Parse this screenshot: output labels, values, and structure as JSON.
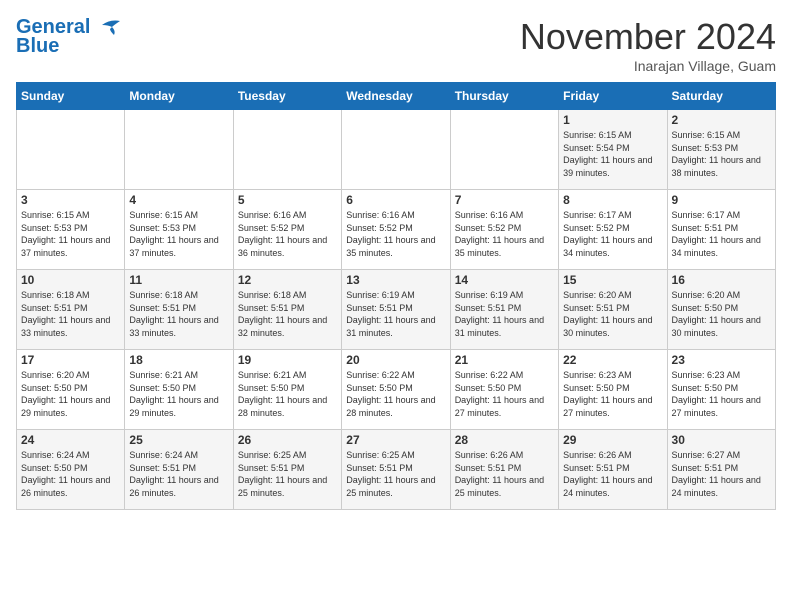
{
  "header": {
    "logo_line1": "General",
    "logo_line2": "Blue",
    "month": "November 2024",
    "location": "Inarajan Village, Guam"
  },
  "days_of_week": [
    "Sunday",
    "Monday",
    "Tuesday",
    "Wednesday",
    "Thursday",
    "Friday",
    "Saturday"
  ],
  "weeks": [
    [
      {
        "day": "",
        "info": ""
      },
      {
        "day": "",
        "info": ""
      },
      {
        "day": "",
        "info": ""
      },
      {
        "day": "",
        "info": ""
      },
      {
        "day": "",
        "info": ""
      },
      {
        "day": "1",
        "info": "Sunrise: 6:15 AM\nSunset: 5:54 PM\nDaylight: 11 hours and 39 minutes."
      },
      {
        "day": "2",
        "info": "Sunrise: 6:15 AM\nSunset: 5:53 PM\nDaylight: 11 hours and 38 minutes."
      }
    ],
    [
      {
        "day": "3",
        "info": "Sunrise: 6:15 AM\nSunset: 5:53 PM\nDaylight: 11 hours and 37 minutes."
      },
      {
        "day": "4",
        "info": "Sunrise: 6:15 AM\nSunset: 5:53 PM\nDaylight: 11 hours and 37 minutes."
      },
      {
        "day": "5",
        "info": "Sunrise: 6:16 AM\nSunset: 5:52 PM\nDaylight: 11 hours and 36 minutes."
      },
      {
        "day": "6",
        "info": "Sunrise: 6:16 AM\nSunset: 5:52 PM\nDaylight: 11 hours and 35 minutes."
      },
      {
        "day": "7",
        "info": "Sunrise: 6:16 AM\nSunset: 5:52 PM\nDaylight: 11 hours and 35 minutes."
      },
      {
        "day": "8",
        "info": "Sunrise: 6:17 AM\nSunset: 5:52 PM\nDaylight: 11 hours and 34 minutes."
      },
      {
        "day": "9",
        "info": "Sunrise: 6:17 AM\nSunset: 5:51 PM\nDaylight: 11 hours and 34 minutes."
      }
    ],
    [
      {
        "day": "10",
        "info": "Sunrise: 6:18 AM\nSunset: 5:51 PM\nDaylight: 11 hours and 33 minutes."
      },
      {
        "day": "11",
        "info": "Sunrise: 6:18 AM\nSunset: 5:51 PM\nDaylight: 11 hours and 33 minutes."
      },
      {
        "day": "12",
        "info": "Sunrise: 6:18 AM\nSunset: 5:51 PM\nDaylight: 11 hours and 32 minutes."
      },
      {
        "day": "13",
        "info": "Sunrise: 6:19 AM\nSunset: 5:51 PM\nDaylight: 11 hours and 31 minutes."
      },
      {
        "day": "14",
        "info": "Sunrise: 6:19 AM\nSunset: 5:51 PM\nDaylight: 11 hours and 31 minutes."
      },
      {
        "day": "15",
        "info": "Sunrise: 6:20 AM\nSunset: 5:51 PM\nDaylight: 11 hours and 30 minutes."
      },
      {
        "day": "16",
        "info": "Sunrise: 6:20 AM\nSunset: 5:50 PM\nDaylight: 11 hours and 30 minutes."
      }
    ],
    [
      {
        "day": "17",
        "info": "Sunrise: 6:20 AM\nSunset: 5:50 PM\nDaylight: 11 hours and 29 minutes."
      },
      {
        "day": "18",
        "info": "Sunrise: 6:21 AM\nSunset: 5:50 PM\nDaylight: 11 hours and 29 minutes."
      },
      {
        "day": "19",
        "info": "Sunrise: 6:21 AM\nSunset: 5:50 PM\nDaylight: 11 hours and 28 minutes."
      },
      {
        "day": "20",
        "info": "Sunrise: 6:22 AM\nSunset: 5:50 PM\nDaylight: 11 hours and 28 minutes."
      },
      {
        "day": "21",
        "info": "Sunrise: 6:22 AM\nSunset: 5:50 PM\nDaylight: 11 hours and 27 minutes."
      },
      {
        "day": "22",
        "info": "Sunrise: 6:23 AM\nSunset: 5:50 PM\nDaylight: 11 hours and 27 minutes."
      },
      {
        "day": "23",
        "info": "Sunrise: 6:23 AM\nSunset: 5:50 PM\nDaylight: 11 hours and 27 minutes."
      }
    ],
    [
      {
        "day": "24",
        "info": "Sunrise: 6:24 AM\nSunset: 5:50 PM\nDaylight: 11 hours and 26 minutes."
      },
      {
        "day": "25",
        "info": "Sunrise: 6:24 AM\nSunset: 5:51 PM\nDaylight: 11 hours and 26 minutes."
      },
      {
        "day": "26",
        "info": "Sunrise: 6:25 AM\nSunset: 5:51 PM\nDaylight: 11 hours and 25 minutes."
      },
      {
        "day": "27",
        "info": "Sunrise: 6:25 AM\nSunset: 5:51 PM\nDaylight: 11 hours and 25 minutes."
      },
      {
        "day": "28",
        "info": "Sunrise: 6:26 AM\nSunset: 5:51 PM\nDaylight: 11 hours and 25 minutes."
      },
      {
        "day": "29",
        "info": "Sunrise: 6:26 AM\nSunset: 5:51 PM\nDaylight: 11 hours and 24 minutes."
      },
      {
        "day": "30",
        "info": "Sunrise: 6:27 AM\nSunset: 5:51 PM\nDaylight: 11 hours and 24 minutes."
      }
    ]
  ]
}
